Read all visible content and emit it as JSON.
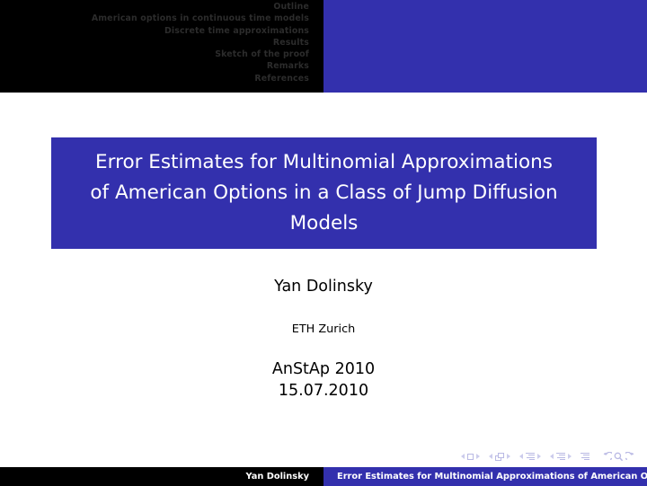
{
  "colors": {
    "accent_blue": "#3330AD",
    "header_black": "#000000",
    "outline_text": "#2C2C2C",
    "nav_symbol": "#B9B9E4",
    "slide_background": "#FFFFFF"
  },
  "header": {
    "outline_items": [
      "Outline",
      "American options in continuous time models",
      "Discrete time approximations",
      "Results",
      "Sketch of the proof",
      "Remarks",
      "References"
    ]
  },
  "title_block": {
    "lines": [
      "Error Estimates for Multinomial Approximations",
      "of American Options in a Class of Jump Diffusion",
      "Models"
    ]
  },
  "author_block": {
    "author": "Yan Dolinsky",
    "institute": "ETH Zurich",
    "event": "AnStAp 2010",
    "date": "15.07.2010"
  },
  "nav_symbols": {
    "items": [
      "previous-slide-icon",
      "current-slide-icon",
      "next-slide-icon",
      "previous-frame-icon",
      "current-frame-icon",
      "next-frame-icon",
      "previous-subsection-icon",
      "current-subsection-icon",
      "next-subsection-icon",
      "previous-section-icon",
      "current-section-icon",
      "next-section-icon",
      "table-of-contents-icon",
      "back-icon",
      "find-icon",
      "forward-icon"
    ]
  },
  "footer": {
    "author": "Yan Dolinsky",
    "title": "Error Estimates for Multinomial Approximations of American O"
  }
}
